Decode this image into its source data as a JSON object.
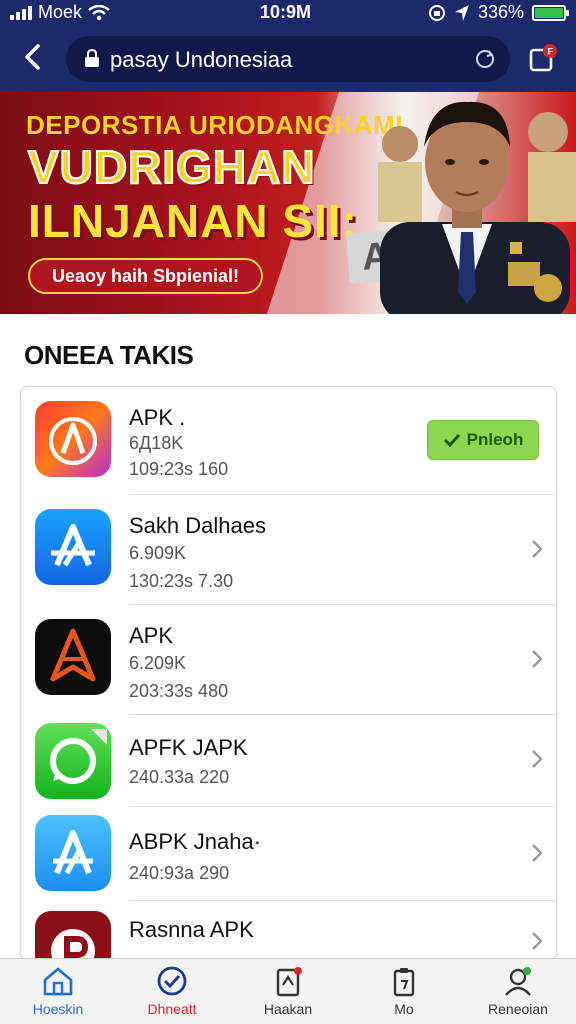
{
  "status_bar": {
    "carrier": "Moek",
    "time": "10:9M",
    "battery": "336%"
  },
  "browser": {
    "url": "pasay Undonesiaa",
    "back_icon": "chevron-left-icon",
    "lock_icon": "lock-icon",
    "reload_icon": "reload-icon",
    "tabs_icon": "tabs-icon"
  },
  "banner": {
    "line1": "DEPORSTIA URIODANGKAMI",
    "line2": "VUDRIGHAN",
    "line3": "ILNJANAN SII:",
    "cta": "Ueaoy haih Sbpienial!",
    "sign_letter": "A"
  },
  "section_title": "ONEEA TAKIS",
  "apps": [
    {
      "name": "APK .",
      "size": "6Д18K",
      "meta": "109:23s  160",
      "icon": "apk-red-orange-icon",
      "action": "Pnleoh"
    },
    {
      "name": "Sakh Dalhaes",
      "size": "6.909K",
      "meta": "130:23s  7.30",
      "icon": "app-store-blue-icon"
    },
    {
      "name": "APK",
      "size": "6.209K",
      "meta": "203:33s  480",
      "icon": "apk-black-orange-icon"
    },
    {
      "name": "APFK JAPK",
      "size": "",
      "meta": "240.33a  220",
      "icon": "whatsapp-green-icon"
    },
    {
      "name": "ABPK Jnaha·",
      "size": "",
      "meta": "240:93a  290",
      "icon": "app-store-light-blue-icon"
    },
    {
      "name": "Rasnna APK",
      "size": "",
      "meta": "",
      "icon": "apk-dark-red-icon"
    }
  ],
  "bottom_nav": [
    {
      "label": "Hoeskin",
      "icon": "home-icon",
      "color": "#1f6fd0"
    },
    {
      "label": "Dhneatt",
      "icon": "check-circle-icon",
      "color": "#d0282c"
    },
    {
      "label": "Haakan",
      "icon": "clipboard-icon",
      "color": "#333333"
    },
    {
      "label": "Mo",
      "icon": "document-icon",
      "color": "#333333"
    },
    {
      "label": "Reneoian",
      "icon": "person-icon",
      "color": "#333333"
    }
  ],
  "colors": {
    "navy": "#1c2a6b",
    "banner_red": "#b0141c",
    "banner_yellow": "#f7d22a",
    "refresh_green": "#8ed64e"
  }
}
